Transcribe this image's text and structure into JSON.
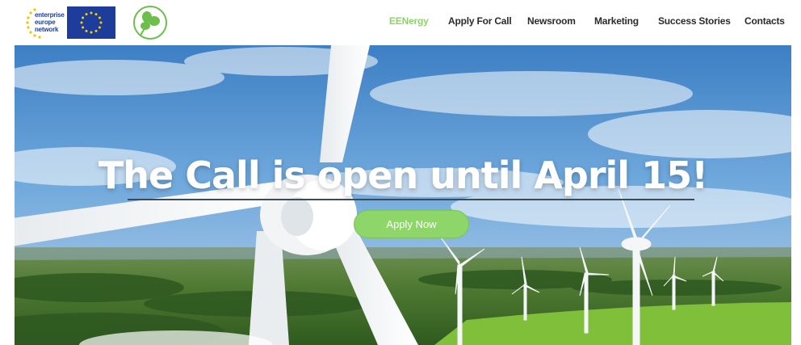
{
  "brand": {
    "een_logo_lines": [
      "enterprise",
      "europe",
      "network"
    ],
    "accent_color": "#8ed36a",
    "eu_flag_color": "#1e3c9a",
    "icons": [
      "een-stars-icon",
      "eu-flag-icon",
      "clover-leaf-icon"
    ]
  },
  "nav": {
    "items": [
      {
        "label": "EENergy",
        "active": true
      },
      {
        "label": "Apply For Call",
        "active": false
      },
      {
        "label": "Newsroom",
        "active": false
      },
      {
        "label": "Marketing",
        "active": false
      },
      {
        "label": "Success Stories",
        "active": false
      },
      {
        "label": "Contacts",
        "active": false
      }
    ]
  },
  "hero": {
    "title": "The Call is open until April 15!",
    "button_label": "Apply Now",
    "button_color": "#8fd66a"
  }
}
